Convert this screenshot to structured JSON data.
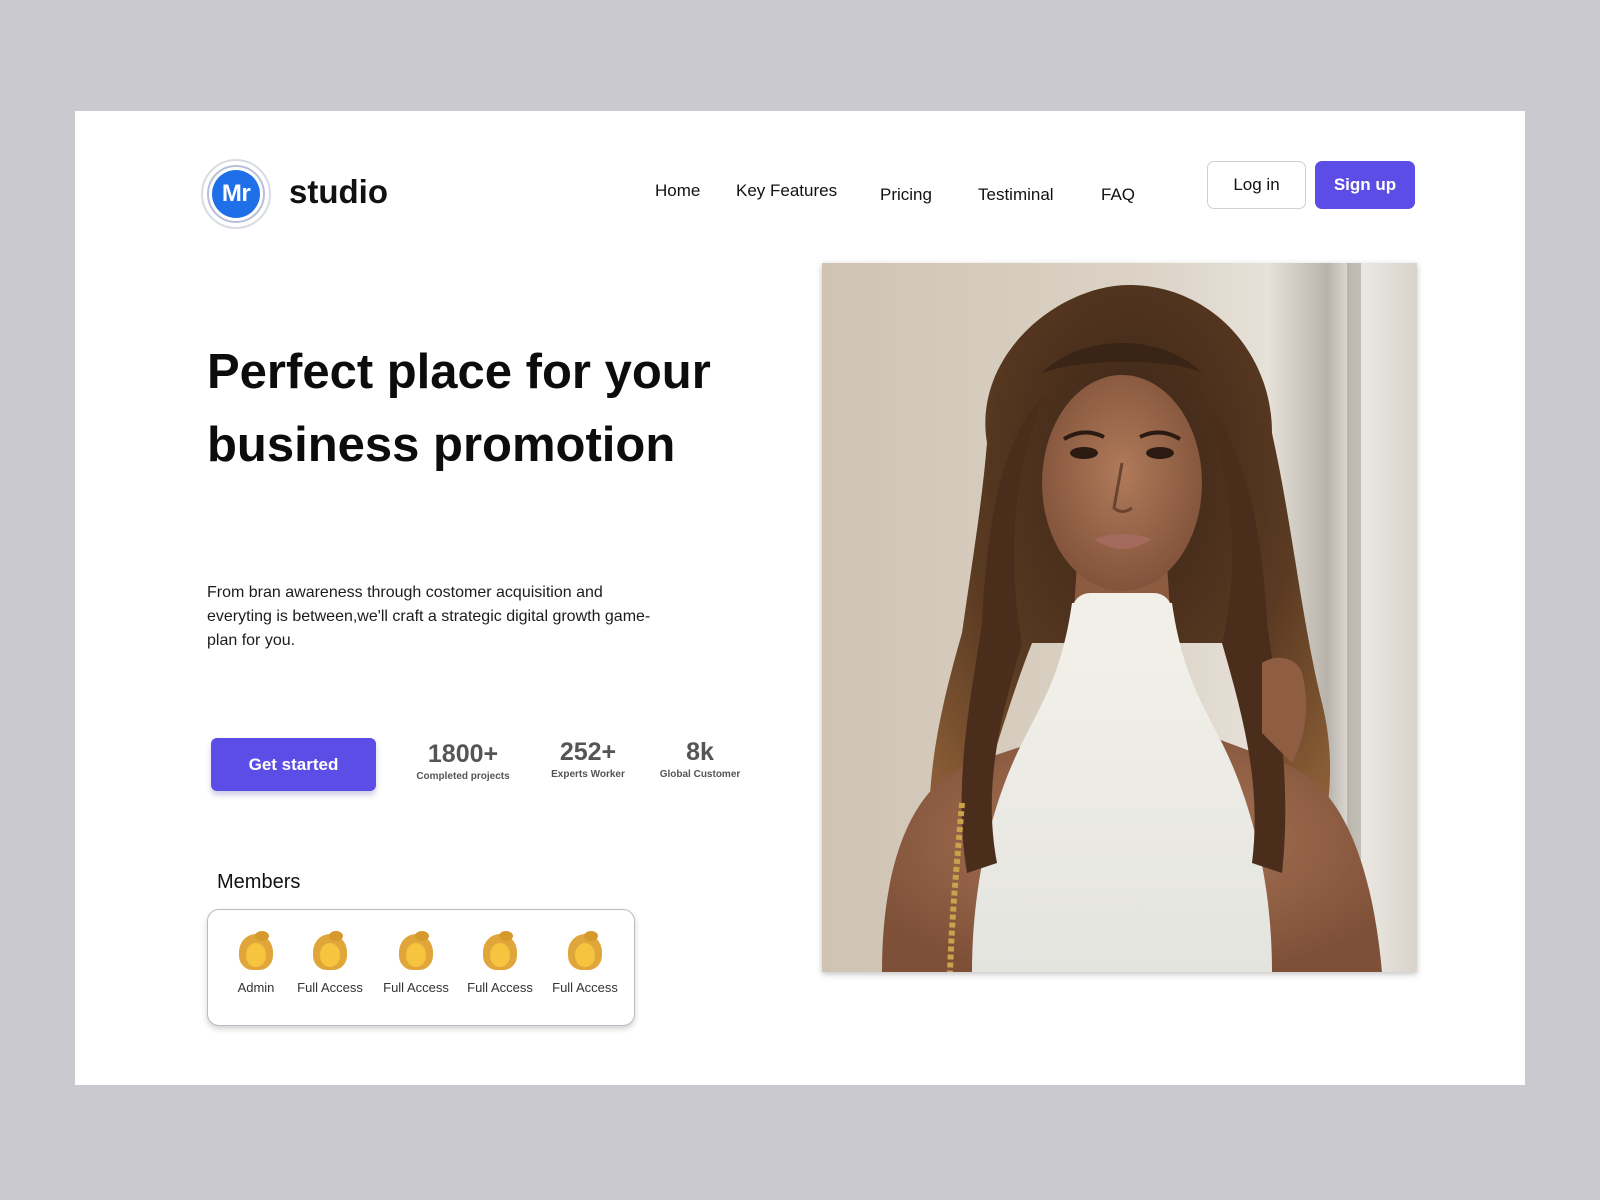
{
  "header": {
    "logo_text": "Mr",
    "brand": "studio",
    "nav": [
      {
        "label": "Home"
      },
      {
        "label": "Key Features"
      },
      {
        "label": "Pricing"
      },
      {
        "label": "Testiminal"
      },
      {
        "label": "FAQ"
      }
    ],
    "login_label": "Log in",
    "signup_label": "Sign up"
  },
  "hero": {
    "headline": "Perfect place for your business promotion",
    "subtext": "From bran awareness through costomer acquisition and everyting is between,we'll craft a strategic digital growth game-plan for you.",
    "cta_label": "Get started"
  },
  "stats": [
    {
      "value": "1800+",
      "label": "Completed projects"
    },
    {
      "value": "252+",
      "label": "Experts Worker"
    },
    {
      "value": "8k",
      "label": "Global Customer"
    }
  ],
  "members": {
    "title": "Members",
    "items": [
      {
        "label": "Admin",
        "icon": "woman-blond-emoji"
      },
      {
        "label": "Full Access",
        "icon": "woman-blond-emoji"
      },
      {
        "label": "Full Access",
        "icon": "woman-blond-emoji"
      },
      {
        "label": "Full Access",
        "icon": "woman-blond-emoji"
      },
      {
        "label": "Full Access",
        "icon": "woman-blond-emoji"
      }
    ]
  },
  "colors": {
    "accent": "#5b4de6",
    "logo_blue": "#1e6fe8",
    "page_background": "#c9c9cf"
  }
}
